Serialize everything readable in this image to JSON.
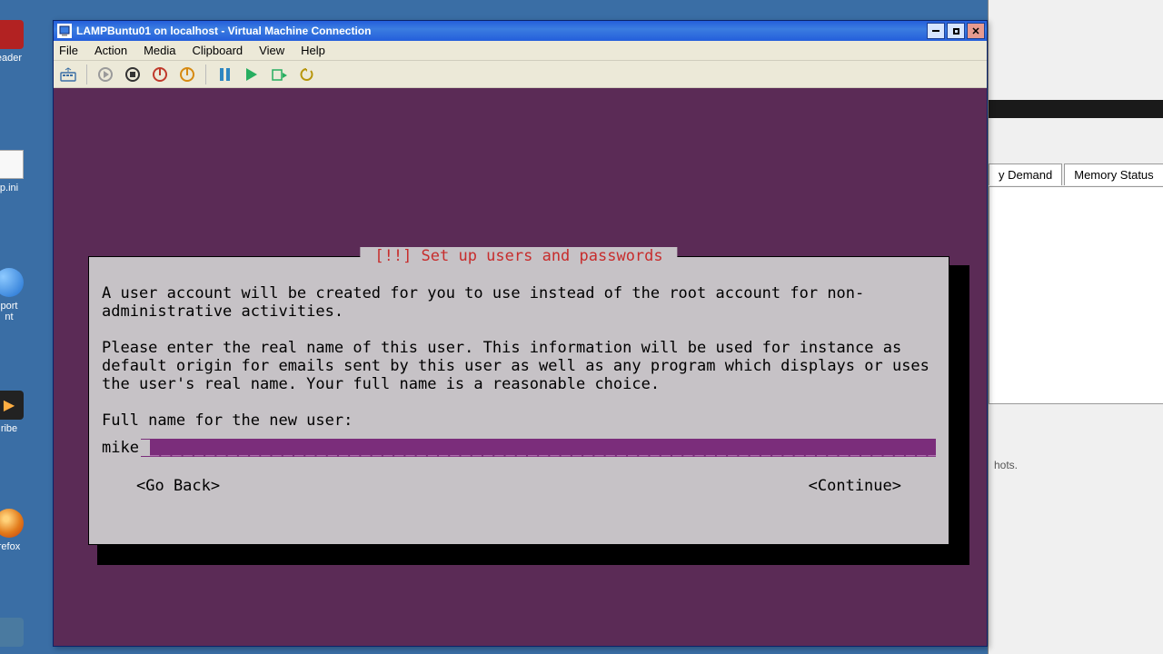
{
  "desktop": {
    "icons": [
      {
        "label": "eader",
        "color": "#b22222"
      },
      {
        "label": "p.ini",
        "color": "#e8e8e8"
      },
      {
        "label": "port\nnt",
        "color": "#1e90ff"
      },
      {
        "label": "ribe",
        "color": "#2b2b2b"
      },
      {
        "label": "refox",
        "color": "#e27b1b"
      },
      {
        "label": "",
        "color": "#4a7aa0"
      }
    ]
  },
  "window": {
    "title": "LAMPBuntu01 on localhost - Virtual Machine Connection",
    "menu": [
      "File",
      "Action",
      "Media",
      "Clipboard",
      "View",
      "Help"
    ],
    "wincontrols": {
      "min": "_",
      "max": "❐",
      "close": "✕"
    }
  },
  "installer": {
    "title": "[!!] Set up users and passwords",
    "para1": "A user account will be created for you to use instead of the root account for non-administrative activities.",
    "para2": "Please enter the real name of this user. This information will be used for instance as default origin for emails sent by this user as well as any program which displays or uses the user's real name. Your full name is a reasonable choice.",
    "prompt": "Full name for the new user:",
    "input_value": "mike",
    "go_back": "<Go Back>",
    "continue": "<Continue>"
  },
  "background_window": {
    "tab1": "y Demand",
    "tab2": "Memory Status",
    "hint": "hots."
  }
}
